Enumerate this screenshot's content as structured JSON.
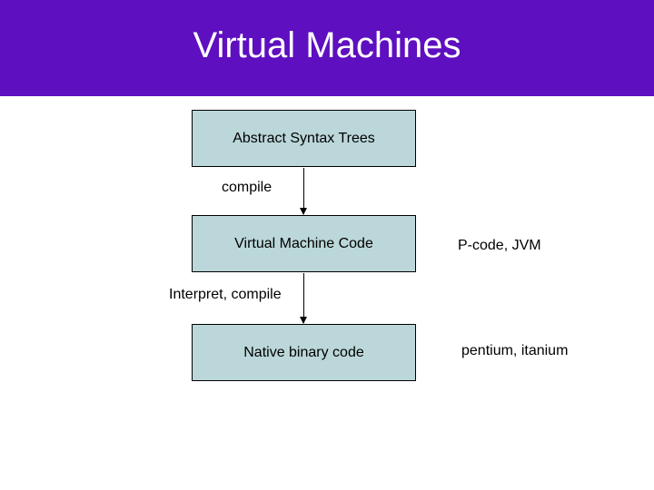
{
  "title": "Virtual Machines",
  "boxes": {
    "ast": "Abstract Syntax Trees",
    "vmcode": "Virtual Machine Code",
    "native": "Native binary code"
  },
  "edge_labels": {
    "compile": "compile",
    "interpret_compile": "Interpret, compile"
  },
  "annotations": {
    "pcode_jvm": "P-code, JVM",
    "pentium_itanium": "pentium, itanium"
  }
}
